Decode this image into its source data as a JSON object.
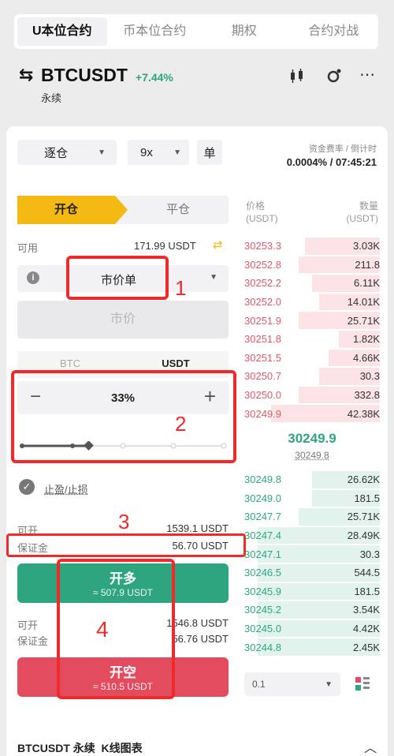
{
  "tabs": [
    "U本位合约",
    "币本位合约",
    "期权",
    "合约对战"
  ],
  "symbol": {
    "name": "BTCUSDT",
    "change": "+7.44%",
    "type": "永续"
  },
  "settings": {
    "margin_mode": "逐仓",
    "leverage": "9x",
    "mode": "单",
    "rate_label": "资金费率 / 倒计时",
    "rate_value": "0.0004% / 07:45:21"
  },
  "order": {
    "open_tab": "开仓",
    "close_tab": "平仓",
    "available_label": "可用",
    "available_value": "171.99 USDT",
    "order_type": "市价单",
    "price_placeholder": "市价",
    "unit_btc": "BTC",
    "unit_usdt": "USDT",
    "percent": "33%",
    "tpsl": "止盈/止损",
    "long_open_label": "可开",
    "long_open_value": "1539.1 USDT",
    "long_margin_label": "保证金",
    "long_margin_value": "56.70 USDT",
    "buy_label": "开多",
    "buy_sub": "≈ 507.9 USDT",
    "short_open_label": "可开",
    "short_open_value": "1546.8 USDT",
    "short_margin_label": "保证金",
    "short_margin_value": "56.76 USDT",
    "sell_label": "开空",
    "sell_sub": "≈ 510.5 USDT"
  },
  "book": {
    "price_header": "价格",
    "price_unit": "(USDT)",
    "qty_header": "数量",
    "qty_unit": "(USDT)",
    "asks": [
      {
        "p": "30253.3",
        "q": "3.03K",
        "d": 0.55
      },
      {
        "p": "30252.8",
        "q": "211.8",
        "d": 0.6
      },
      {
        "p": "30252.2",
        "q": "6.11K",
        "d": 0.5
      },
      {
        "p": "30252.0",
        "q": "14.01K",
        "d": 0.45
      },
      {
        "p": "30251.9",
        "q": "25.71K",
        "d": 0.6
      },
      {
        "p": "30251.8",
        "q": "1.82K",
        "d": 0.3
      },
      {
        "p": "30251.5",
        "q": "4.66K",
        "d": 0.38
      },
      {
        "p": "30250.7",
        "q": "30.3",
        "d": 0.45
      },
      {
        "p": "30250.0",
        "q": "332.8",
        "d": 0.6
      },
      {
        "p": "30249.9",
        "q": "42.38K",
        "d": 0.8
      }
    ],
    "last": "30249.9",
    "mark": "30249.8",
    "bids": [
      {
        "p": "30249.8",
        "q": "26.62K",
        "d": 0.5
      },
      {
        "p": "30249.0",
        "q": "181.5",
        "d": 0.5
      },
      {
        "p": "30247.7",
        "q": "25.71K",
        "d": 0.6
      },
      {
        "p": "30247.4",
        "q": "28.49K",
        "d": 0.9
      },
      {
        "p": "30247.1",
        "q": "30.3",
        "d": 0.9
      },
      {
        "p": "30246.5",
        "q": "544.5",
        "d": 0.9
      },
      {
        "p": "30245.9",
        "q": "181.5",
        "d": 0.9
      },
      {
        "p": "30245.2",
        "q": "3.54K",
        "d": 0.9
      },
      {
        "p": "30245.0",
        "q": "4.42K",
        "d": 0.9
      },
      {
        "p": "30244.8",
        "q": "2.45K",
        "d": 0.9
      }
    ],
    "depth": "0.1"
  },
  "annotations": [
    "1",
    "2",
    "3",
    "4"
  ],
  "footer": "BTCUSDT 永续  K线图表",
  "colors": {
    "accent": "#f5b914",
    "green": "#2ea57f",
    "red": "#e24c5e",
    "annotation": "#ee2a2a"
  }
}
